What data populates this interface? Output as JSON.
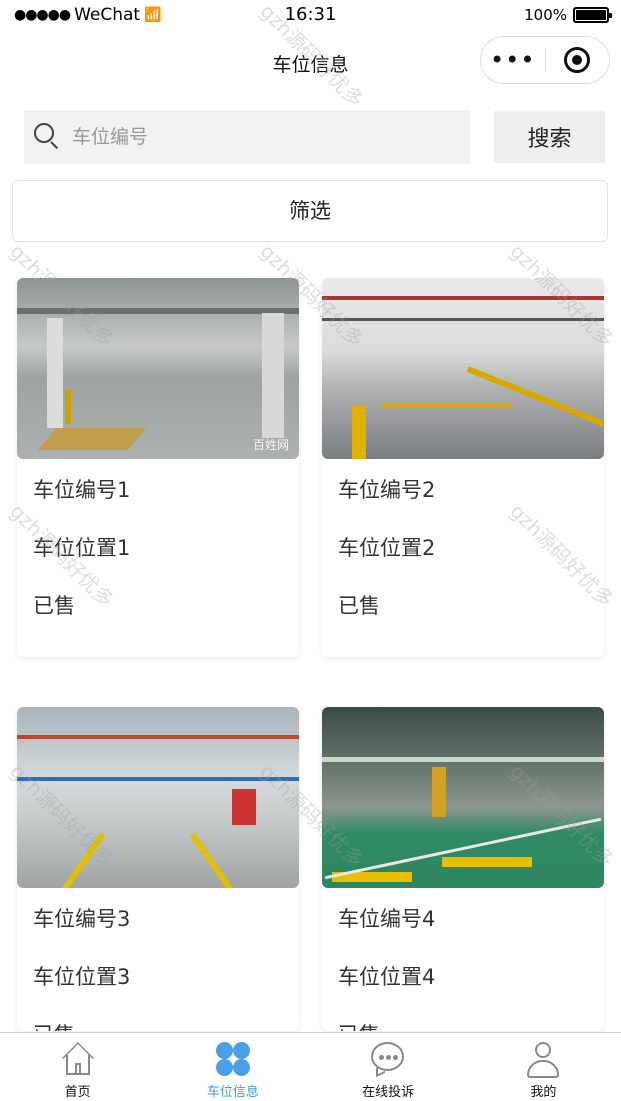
{
  "status_bar": {
    "carrier": "WeChat",
    "time": "16:31",
    "battery": "100%"
  },
  "nav": {
    "title": "车位信息",
    "more_icon": "more-dots-icon",
    "close_icon": "target-close-icon"
  },
  "search": {
    "placeholder": "车位编号",
    "value": "",
    "button_label": "搜索"
  },
  "filter": {
    "label": "筛选"
  },
  "cards": [
    {
      "number": "车位编号1",
      "location": "车位位置1",
      "status": "已售",
      "image_badge": "百姓网"
    },
    {
      "number": "车位编号2",
      "location": "车位位置2",
      "status": "已售"
    },
    {
      "number": "车位编号3",
      "location": "车位位置3",
      "status": "已售"
    },
    {
      "number": "车位编号4",
      "location": "车位位置4",
      "status": "已售"
    }
  ],
  "tab_bar": {
    "active_color": "#3a9ae8",
    "items": [
      {
        "label": "首页",
        "icon": "home-icon"
      },
      {
        "label": "车位信息",
        "icon": "grid-icon",
        "active": true
      },
      {
        "label": "在线投诉",
        "icon": "chat-icon"
      },
      {
        "label": "我的",
        "icon": "user-icon"
      }
    ]
  },
  "watermark": "gzh源码好优多"
}
